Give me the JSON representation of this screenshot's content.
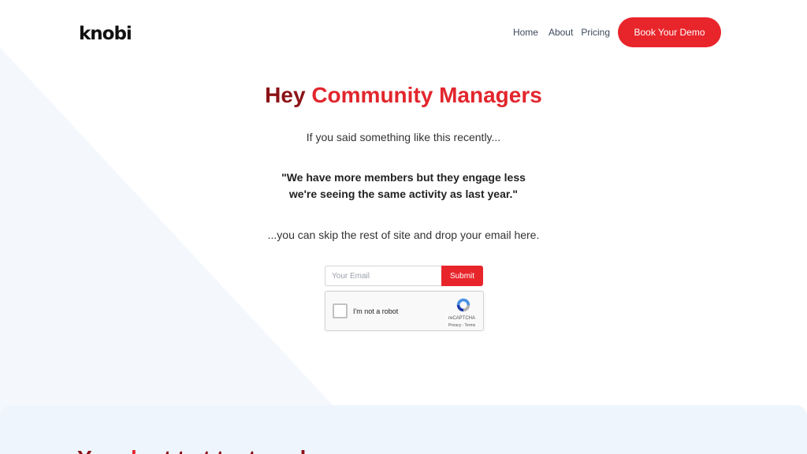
{
  "header": {
    "logo_text": "knobi",
    "nav": [
      {
        "label": "Home"
      },
      {
        "label": "About"
      },
      {
        "label": "Pricing"
      }
    ],
    "cta_label": "Book Your Demo"
  },
  "hero": {
    "title_lead": "Hey ",
    "title_highlight": "Community Managers",
    "intro": "If you said something like this recently...",
    "quote_line1": "\"We have more members but they engage less",
    "quote_line2": "we're seeing the same activity as last year.\"",
    "skip_text": "...you can skip the rest of site and drop your email here."
  },
  "form": {
    "email_placeholder": "Your Email",
    "email_value": "",
    "submit_label": "Submit"
  },
  "recaptcha": {
    "label": "I'm not a robot",
    "brand": "reCAPTCHA",
    "links": "Privacy - Terms"
  },
  "next_section": {
    "title_lead": "You ",
    "title_highlight": "dou",
    "title_rest": "t ta t t e ta e d"
  },
  "colors": {
    "brand_red": "#e8252b",
    "dark_red": "#8b1216",
    "bottom_bg": "#eef5fc"
  }
}
